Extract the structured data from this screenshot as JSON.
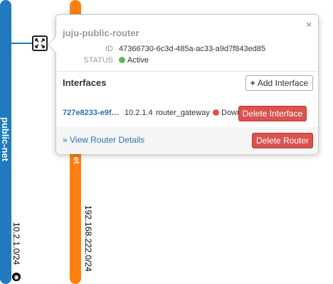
{
  "networks": [
    {
      "name": "public-net",
      "cidr": "10.2.1.0/24",
      "color": "#1f7ac0",
      "icon": "globe-icon"
    },
    {
      "name": "et",
      "cidr": "192.168.222.0/24",
      "color": "#ff7f0e"
    }
  ],
  "router_node": {
    "icon": "router-icon"
  },
  "popup": {
    "close": "×",
    "title": "juju-public-router",
    "id_label": "ID",
    "id_value": "47366730-6c3d-485a-ac33-a9d7f843ed85",
    "status_label": "STATUS",
    "status_value": "Active",
    "status_color": "#5cb85c",
    "interfaces_title": "Interfaces",
    "add_interface": "Add Interface",
    "interfaces": [
      {
        "id": "727e8233-e9f…",
        "ip": "10.2.1.4",
        "owner": "router_gateway",
        "status": "Down",
        "status_color": "#d9534f",
        "delete_label": "Delete Interface"
      }
    ],
    "view_details": "» View Router Details",
    "delete_router": "Delete Router"
  }
}
